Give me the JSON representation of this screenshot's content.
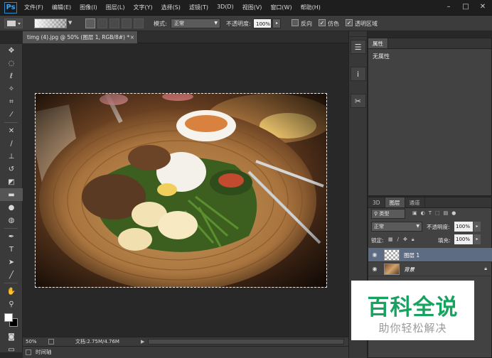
{
  "app": {
    "logo": "Ps"
  },
  "menu": [
    "文件(F)",
    "编辑(E)",
    "图像(I)",
    "图层(L)",
    "文字(Y)",
    "选择(S)",
    "滤镜(T)",
    "3D(D)",
    "视图(V)",
    "窗口(W)",
    "帮助(H)"
  ],
  "window_controls": {
    "minimize": "–",
    "restore": "□",
    "close": "✕"
  },
  "options": {
    "mode_label": "模式:",
    "mode_value": "正常",
    "opacity_label": "不透明度:",
    "opacity_value": "100%",
    "reverse_label": "反向",
    "dither_label": "仿色",
    "transparency_label": "透明区域",
    "dither_checked": true,
    "transparency_checked": true,
    "reverse_checked": false
  },
  "document": {
    "tab_title": "timg (4).jpg @ 50% (图层 1, RGB/8#) *",
    "tab_close": "×"
  },
  "status": {
    "zoom": "50%",
    "doc_info": "文档:2.75M/4.76M"
  },
  "timeline": {
    "label": "时间轴"
  },
  "properties": {
    "tab": "属性",
    "content": "无属性"
  },
  "layers": {
    "tabs": [
      "3D",
      "图层",
      "通道"
    ],
    "active_tab": 1,
    "filter_label": "类型",
    "blend_mode": "正常",
    "opacity_label": "不透明度:",
    "opacity_value": "100%",
    "lock_label": "锁定:",
    "fill_label": "填充:",
    "fill_value": "100%",
    "items": [
      {
        "name": "图层 1",
        "selected": true
      },
      {
        "name": "背景",
        "selected": false
      }
    ]
  },
  "watermark": {
    "title": "百科全说",
    "subtitle": "助你轻松解决"
  },
  "colors": {
    "foreground": "#ffffff",
    "background": "#000000",
    "watermark_green": "#17a35f",
    "selected_layer": "#5d6c82"
  }
}
